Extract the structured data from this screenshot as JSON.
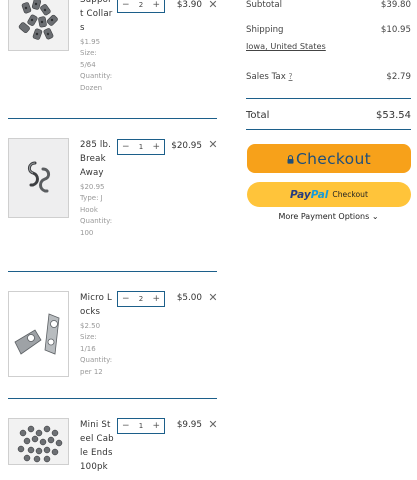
{
  "cart": {
    "items": [
      {
        "name": "Support Collars",
        "price_each": "$1.95",
        "option": "Size: 5/64",
        "quantity_unit": "Quantity: Dozen",
        "qty": "2",
        "line_total": "$3.90"
      },
      {
        "name": "285 lb. Break Away",
        "price_each": "$20.95",
        "option": "Type: J Hook",
        "quantity_unit": "Quantity: 100",
        "qty": "1",
        "line_total": "$20.95"
      },
      {
        "name": "Micro Locks",
        "price_each": "$2.50",
        "option": "Size: 1/16",
        "quantity_unit": "Quantity: per 12",
        "qty": "2",
        "line_total": "$5.00"
      },
      {
        "name": "Mini Steel Cable Ends 100pk",
        "price_each": "",
        "option": "",
        "quantity_unit": "",
        "qty": "1",
        "line_total": "$9.95"
      }
    ],
    "minus_glyph": "−",
    "plus_glyph": "+",
    "remove_glyph": "✕"
  },
  "summary": {
    "subtotal_label": "Subtotal",
    "subtotal_value": "$39.80",
    "shipping_label": "Shipping",
    "shipping_value": "$10.95",
    "shipping_location": "Iowa, United States",
    "tax_label": "Sales Tax",
    "tax_help": "?",
    "tax_value": "$2.79",
    "total_label": "Total",
    "total_value": "$53.54"
  },
  "checkout": {
    "checkout_label": "Checkout",
    "paypal_part1": "Pay",
    "paypal_part2": "Pal",
    "paypal_checkout": "Checkout",
    "more_payment_options": "More Payment Options ⌄"
  },
  "colors": {
    "accent_divider": "#1c5f8a",
    "checkout_orange": "#f7a11a",
    "paypal_yellow": "#ffc43a",
    "checkout_text": "#1f4f7a"
  },
  "icons": {
    "remove": "close-icon",
    "lock": "lock-icon",
    "minus": "minus-icon",
    "plus": "plus-icon",
    "chevron": "chevron-down-icon"
  }
}
